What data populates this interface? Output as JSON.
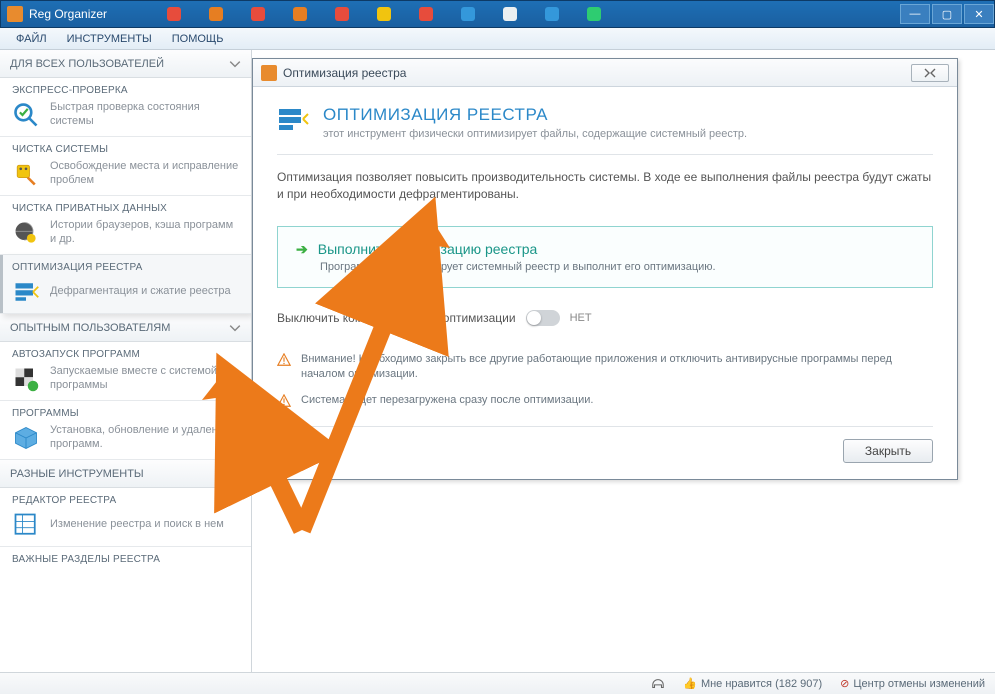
{
  "app": {
    "title": "Reg Organizer"
  },
  "menu": {
    "file": "ФАЙЛ",
    "tools": "ИНСТРУМЕНТЫ",
    "help": "ПОМОЩЬ"
  },
  "sidebar": {
    "section1": "ДЛЯ ВСЕХ ПОЛЬЗОВАТЕЛЕЙ",
    "items1": [
      {
        "title": "ЭКСПРЕСС-ПРОВЕРКА",
        "desc": "Быстрая проверка состояния системы"
      },
      {
        "title": "ЧИСТКА СИСТЕМЫ",
        "desc": "Освобождение места и исправление проблем"
      },
      {
        "title": "ЧИСТКА ПРИВАТНЫХ ДАННЫХ",
        "desc": "Истории браузеров, кэша программ и др."
      },
      {
        "title": "ОПТИМИЗАЦИЯ РЕЕСТРА",
        "desc": "Дефрагментация и сжатие реестра"
      }
    ],
    "section2": "ОПЫТНЫМ ПОЛЬЗОВАТЕЛЯМ",
    "items2": [
      {
        "title": "АВТОЗАПУСК ПРОГРАММ",
        "desc": "Запускаемые вместе с системой программы"
      },
      {
        "title": "ПРОГРАММЫ",
        "desc": "Установка, обновление и удаление программ."
      }
    ],
    "section3": "РАЗНЫЕ ИНСТРУМЕНТЫ",
    "items3": [
      {
        "title": "РЕДАКТОР РЕЕСТРА",
        "desc": "Изменение реестра и поиск в нем"
      },
      {
        "title": "ВАЖНЫЕ РАЗДЕЛЫ РЕЕСТРА",
        "desc": ""
      }
    ]
  },
  "dialog": {
    "title": "Оптимизация реестра",
    "heading": "ОПТИМИЗАЦИЯ РЕЕСТРА",
    "subhead": "этот инструмент физически оптимизирует файлы, содержащие системный реестр.",
    "desc": "Оптимизация позволяет повысить производительность системы. В ходе ее выполнения файлы реестра будут сжаты и при необходимости дефрагментированы.",
    "action_title": "Выполнить оптимизацию реестра",
    "action_desc": "Программа проанализирует системный реестр и выполнит его оптимизацию.",
    "switch_label": "Выключить компьютер после оптимизации",
    "switch_state": "НЕТ",
    "warn1": "Внимание! Необходимо закрыть все другие работающие приложения и отключить антивирусные программы перед началом оптимизации.",
    "warn2": "Система будет перезагружена сразу после оптимизации.",
    "close_btn": "Закрыть"
  },
  "status": {
    "like": "Мне нравится (182 907)",
    "undo": "Центр отмены изменений"
  }
}
